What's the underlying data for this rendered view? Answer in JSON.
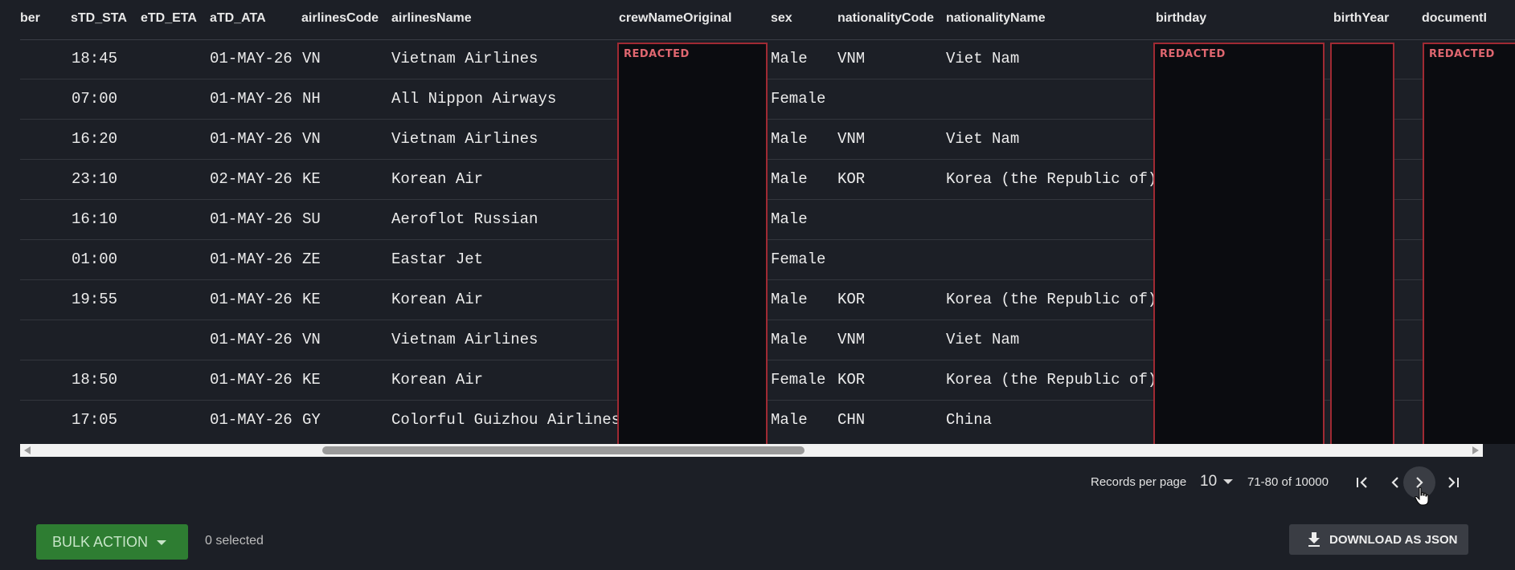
{
  "columns": {
    "flightNumber": "ber",
    "std_sta": "sTD_STA",
    "etd_eta": "eTD_ETA",
    "atd_ata": "aTD_ATA",
    "airlinesCode": "airlinesCode",
    "airlinesName": "airlinesName",
    "crewNameOriginal": "crewNameOriginal",
    "sex": "sex",
    "nationalityCode": "nationalityCode",
    "nationalityName": "nationalityName",
    "birthday": "birthday",
    "birthYear": "birthYear",
    "document": "documentI"
  },
  "redacted_label": "REDACTED",
  "rows": [
    {
      "std": "18:45",
      "etd": "",
      "atd": "01-MAY-26",
      "code": "VN",
      "name": "Vietnam Airlines",
      "sex": "Male",
      "nat_code": "VNM",
      "nat_name": "Viet Nam"
    },
    {
      "std": "07:00",
      "etd": "",
      "atd": "01-MAY-26",
      "code": "NH",
      "name": "All Nippon Airways",
      "sex": "Female",
      "nat_code": "",
      "nat_name": ""
    },
    {
      "std": "16:20",
      "etd": "",
      "atd": "01-MAY-26",
      "code": "VN",
      "name": "Vietnam Airlines",
      "sex": "Male",
      "nat_code": "VNM",
      "nat_name": "Viet Nam"
    },
    {
      "std": "23:10",
      "etd": "",
      "atd": "02-MAY-26",
      "code": "KE",
      "name": "Korean Air",
      "sex": "Male",
      "nat_code": "KOR",
      "nat_name": "Korea (the Republic of)"
    },
    {
      "std": "16:10",
      "etd": "",
      "atd": "01-MAY-26",
      "code": "SU",
      "name": "Aeroflot Russian",
      "sex": "Male",
      "nat_code": "",
      "nat_name": ""
    },
    {
      "std": "01:00",
      "etd": "",
      "atd": "01-MAY-26",
      "code": "ZE",
      "name": "Eastar Jet",
      "sex": "Female",
      "nat_code": "",
      "nat_name": ""
    },
    {
      "std": "19:55",
      "etd": "",
      "atd": "01-MAY-26",
      "code": "KE",
      "name": "Korean Air",
      "sex": "Male",
      "nat_code": "KOR",
      "nat_name": "Korea (the Republic of)"
    },
    {
      "std": "",
      "etd": "",
      "atd": "01-MAY-26",
      "code": "VN",
      "name": "Vietnam Airlines",
      "sex": "Male",
      "nat_code": "VNM",
      "nat_name": "Viet Nam"
    },
    {
      "std": "18:50",
      "etd": "",
      "atd": "01-MAY-26",
      "code": "KE",
      "name": "Korean Air",
      "sex": "Female",
      "nat_code": "KOR",
      "nat_name": "Korea (the Republic of)"
    },
    {
      "std": "17:05",
      "etd": "",
      "atd": "01-MAY-26",
      "code": "GY",
      "name": "Colorful Guizhou Airlines",
      "sex": "Male",
      "nat_code": "CHN",
      "nat_name": "China"
    }
  ],
  "pagination": {
    "records_per_page_label": "Records per page",
    "records_per_page_value": "10",
    "range": "71-80 of 10000"
  },
  "bulk_action": {
    "label": "BULK ACTION",
    "selected": "0 selected"
  },
  "download": {
    "label": "DOWNLOAD AS JSON"
  },
  "colors": {
    "background": "#1c1f26",
    "bulk_green": "#2e7d32",
    "redact_border": "#a02a33"
  }
}
